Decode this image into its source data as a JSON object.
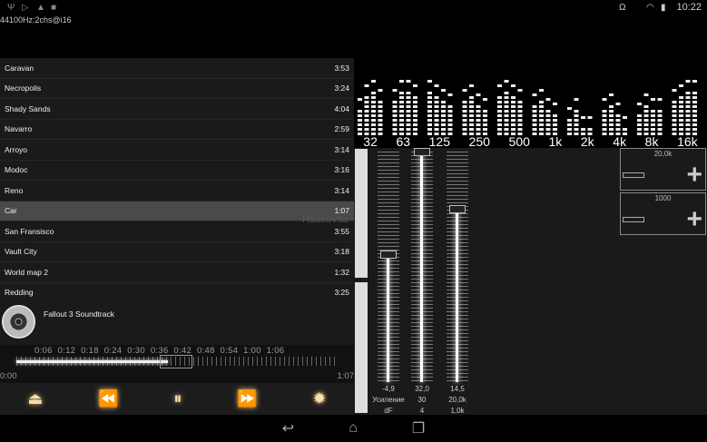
{
  "status": {
    "time": "10:22",
    "format": "44100Hz:2chs@i16"
  },
  "tracks": [
    {
      "title": "Caravan",
      "duration": "3:53"
    },
    {
      "title": "Necropolis",
      "duration": "3:24"
    },
    {
      "title": "Shady Sands",
      "duration": "4:04"
    },
    {
      "title": "Navarro",
      "duration": "2:59"
    },
    {
      "title": "Arroyo",
      "duration": "3:14"
    },
    {
      "title": "Modoc",
      "duration": "3:16"
    },
    {
      "title": "Reno",
      "duration": "3:14"
    },
    {
      "title": "Car",
      "duration": "1:07",
      "selected": true
    },
    {
      "title": "San Fransisco",
      "duration": "3:55"
    },
    {
      "title": "Vault City",
      "duration": "3:18"
    },
    {
      "title": "World map 2",
      "duration": "1:32"
    },
    {
      "title": "Redding",
      "duration": "3:25"
    }
  ],
  "album": {
    "title": "Fallout 3 Soundtrack"
  },
  "timeline": {
    "ticks": "0:06  0:12  0:18  0:24  0:30  0:36  0:42  0:48  0:54  1:00  1:06",
    "start": "0:00",
    "end": "1:07",
    "progress": 0.47
  },
  "controls": {
    "eject": "⏏",
    "prev": "⏪",
    "pause": "⏸",
    "next": "⏩",
    "settings": "✹"
  },
  "spectrum": {
    "bands": [
      "32",
      "63",
      "125",
      "250",
      "500",
      "1k",
      "2k",
      "4k",
      "8k",
      "16k"
    ],
    "levels": [
      [
        0.35,
        0.55,
        0.6,
        0.5
      ],
      [
        0.5,
        0.6,
        0.62,
        0.55
      ],
      [
        0.6,
        0.55,
        0.5,
        0.45
      ],
      [
        0.5,
        0.55,
        0.45,
        0.4
      ],
      [
        0.55,
        0.6,
        0.55,
        0.5
      ],
      [
        0.45,
        0.5,
        0.4,
        0.3
      ],
      [
        0.25,
        0.35,
        0.15,
        0.12
      ],
      [
        0.4,
        0.45,
        0.3,
        0.15
      ],
      [
        0.3,
        0.45,
        0.4,
        0.35
      ],
      [
        0.5,
        0.55,
        0.65,
        0.6
      ]
    ]
  },
  "eq": {
    "sliders": [
      {
        "value": "-4,9",
        "level": 0.55
      },
      {
        "value": "32,0",
        "level": 1.0
      },
      {
        "value": "14,5",
        "level": 0.75
      }
    ],
    "row2": [
      "Усиление",
      "30",
      "20,0k"
    ],
    "row3": [
      "dF",
      "4",
      "1,0k"
    ],
    "box1": "20,0k",
    "box2": "1000"
  },
  "watermark": "HadesVita"
}
